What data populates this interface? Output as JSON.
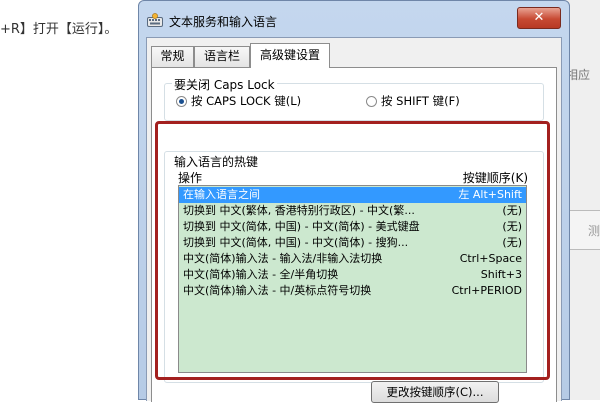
{
  "background": {
    "left_text": "+R】打开【运行】。",
    "right_text_1": "相应",
    "right_text_2": "测"
  },
  "dialog": {
    "title": "文本服务和输入语言",
    "close_symbol": "✕",
    "tabs": [
      {
        "label": "常规",
        "active": false
      },
      {
        "label": "语言栏",
        "active": false
      },
      {
        "label": "高级键设置",
        "active": true
      }
    ],
    "caps_lock": {
      "group_title": "要关闭 Caps Lock",
      "options": [
        {
          "label": "按 CAPS LOCK 键(L)",
          "checked": true
        },
        {
          "label": "按 SHIFT 键(F)",
          "checked": false
        }
      ]
    },
    "hotkeys": {
      "group_title": "输入语言的热键",
      "col_action": "操作",
      "col_sequence": "按键顺序(K)",
      "rows": [
        {
          "action": "在输入语言之间",
          "keys": "左 Alt+Shift",
          "selected": true
        },
        {
          "action": "切换到 中文(繁体, 香港特别行政区) - 中文(繁...",
          "keys": "(无)",
          "selected": false
        },
        {
          "action": "切换到 中文(简体, 中国) - 中文(简体) - 美式键盘",
          "keys": "(无)",
          "selected": false
        },
        {
          "action": "切换到 中文(简体, 中国) - 中文(简体) - 搜狗...",
          "keys": "(无)",
          "selected": false
        },
        {
          "action": "中文(简体)输入法 - 输入法/非输入法切换",
          "keys": "Ctrl+Space",
          "selected": false
        },
        {
          "action": "中文(简体)输入法 - 全/半角切换",
          "keys": "Shift+3",
          "selected": false
        },
        {
          "action": "中文(简体)输入法 - 中/英标点符号切换",
          "keys": "Ctrl+PERIOD",
          "selected": false
        }
      ]
    },
    "change_button": "更改按键顺序(C)..."
  },
  "colors": {
    "list_background": "#cce8cf",
    "selection": "#3399ff",
    "highlight_box": "#a3201f"
  }
}
